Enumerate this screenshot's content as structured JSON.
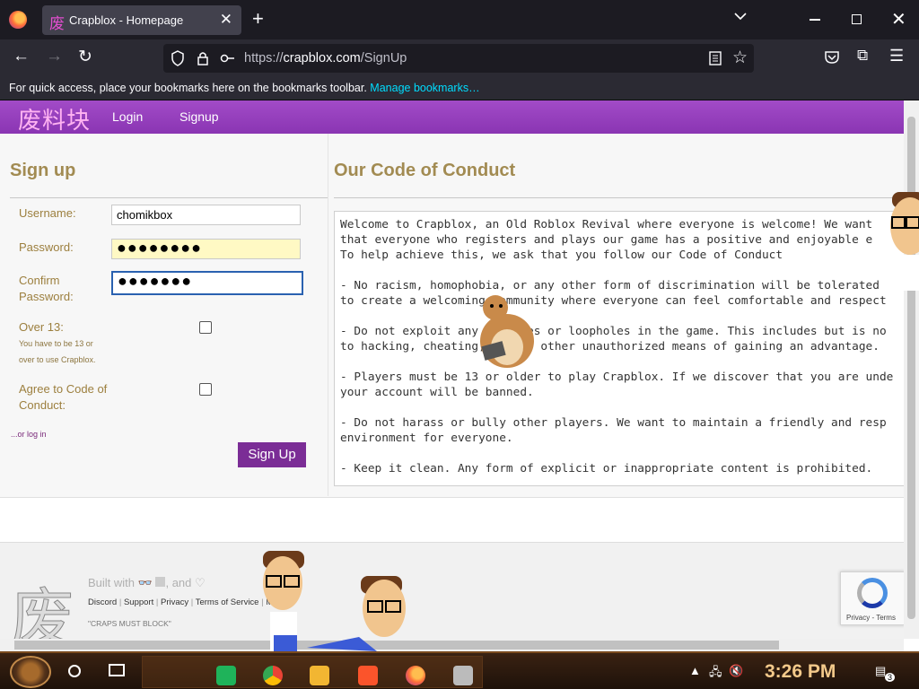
{
  "browser": {
    "tab_title": "Crapblox - Homepage",
    "tab_favicon": "废",
    "url_prefix": "https://",
    "url_host": "crapblox.com",
    "url_path": "/SignUp",
    "bookmarks_text": "For quick access, place your bookmarks here on the bookmarks toolbar.",
    "bookmarks_link": "Manage bookmarks…"
  },
  "site": {
    "logo": "废料块",
    "nav": [
      "Login",
      "Signup"
    ]
  },
  "signup": {
    "title": "Sign up",
    "username_label": "Username:",
    "username_value": "chomikbox",
    "password_label": "Password:",
    "password_value": "●●●●●●●●",
    "confirm_label_1": "Confirm",
    "confirm_label_2": "Password:",
    "confirm_value": "●●●●●●●",
    "over13_label": "Over 13:",
    "over13_note_1": "You have to be 13 or",
    "over13_note_2": "over to use Crapblox.",
    "agree_label_1": "Agree to Code of",
    "agree_label_2": "Conduct:",
    "or_login": "...or log in",
    "submit": "Sign Up"
  },
  "conduct": {
    "title": "Our Code of Conduct",
    "lines": [
      "Welcome to Crapblox, an Old Roblox Revival where everyone is welcome! We want",
      "that everyone who registers and plays our game has a positive and enjoyable e",
      "To help achieve this, we ask that you follow our Code of Conduct",
      "",
      "- No racism, homophobia, or any other form of discrimination will be tolerated",
      "to create a welcoming community where everyone can feel comfortable and respect",
      "",
      "- Do not exploit any glitches or loopholes in the game. This includes but is no",
      "to hacking, cheating, or any other unauthorized means of gaining an advantage.",
      "",
      "- Players must be 13 or older to play Crapblox. If we discover that you are unde",
      "your account will be banned.",
      "",
      "- Do not harass or bully other players. We want to maintain a friendly and resp",
      "environment for everyone.",
      "",
      "- Keep it clean. Any form of explicit or inappropriate content is prohibited."
    ]
  },
  "footer": {
    "logo": "废",
    "built_with": "Built with",
    "built_and": ", and",
    "links": [
      "Discord",
      "Support",
      "Privacy",
      "Terms of Service",
      "M"
    ],
    "motto": "\"CRAPS MUST BLOCK\"",
    "recaptcha": "Privacy - Terms"
  },
  "taskbar": {
    "time": "3:26 PM",
    "notif_count": "3"
  }
}
